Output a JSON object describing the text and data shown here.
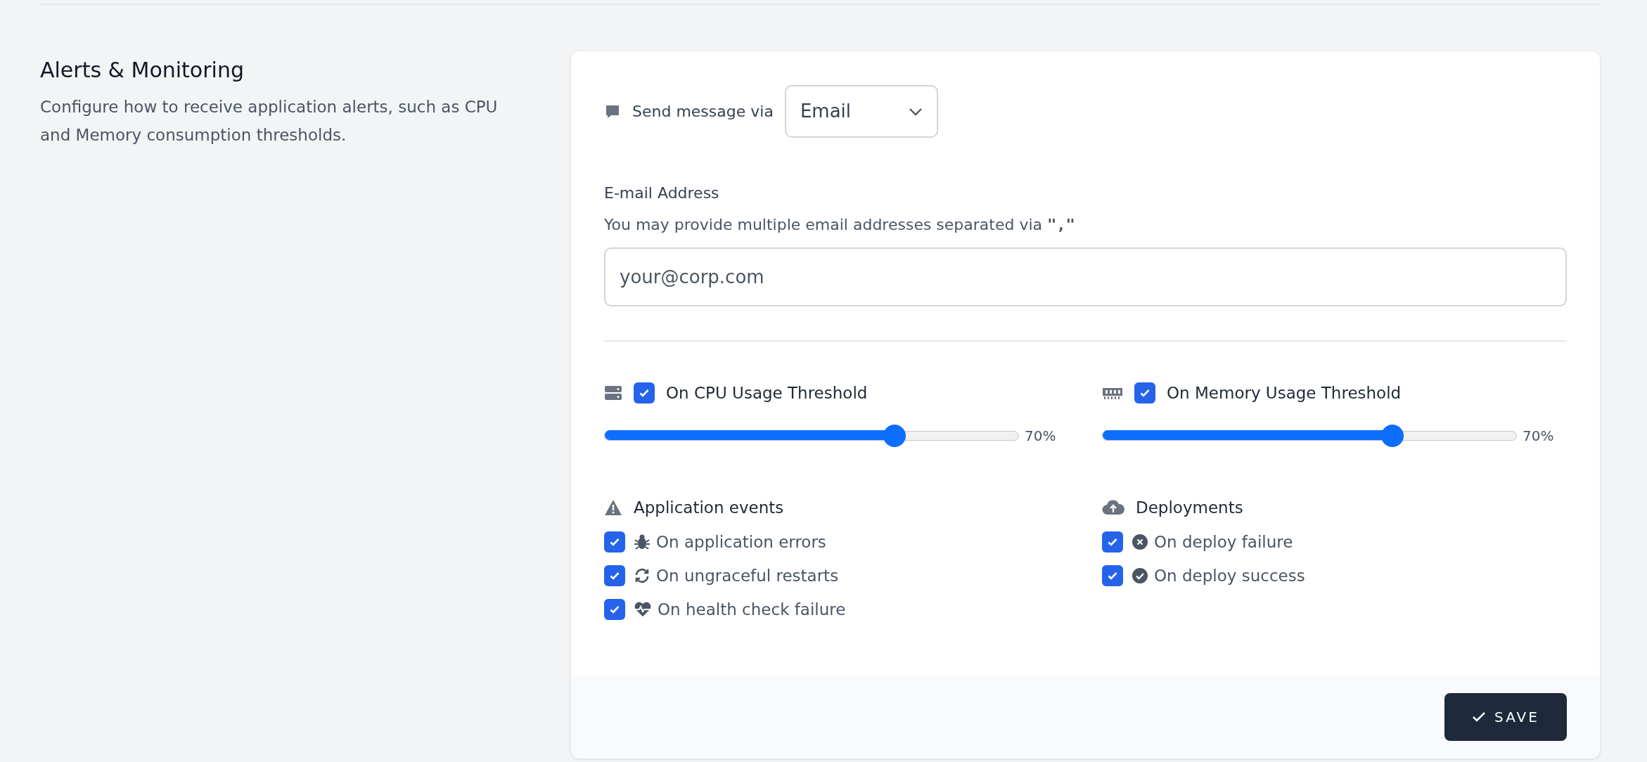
{
  "section": {
    "title": "Alerts & Monitoring",
    "description": "Configure how to receive application alerts, such as CPU and Memory consumption thresholds."
  },
  "channel": {
    "label": "Send message via",
    "value": "Email"
  },
  "email": {
    "label": "E-mail Address",
    "hint": "You may provide multiple email addresses separated via",
    "hint_code": "\",\"",
    "placeholder": "your@corp.com"
  },
  "thresholds": [
    {
      "label": "On CPU Usage Threshold",
      "checked": true,
      "level": 0.7,
      "reading": "70%"
    },
    {
      "label": "On Memory Usage Threshold",
      "checked": true,
      "level": 0.7,
      "reading": "70%"
    }
  ],
  "groups": [
    {
      "title": "Application events",
      "items": [
        {
          "label": "On application errors",
          "checked": true
        },
        {
          "label": "On ungraceful restarts",
          "checked": true
        },
        {
          "label": "On health check failure",
          "checked": true
        }
      ]
    },
    {
      "title": "Deployments",
      "items": [
        {
          "label": "On deploy failure",
          "checked": true
        },
        {
          "label": "On deploy success",
          "checked": true
        }
      ]
    }
  ],
  "save_button": "SAVE"
}
